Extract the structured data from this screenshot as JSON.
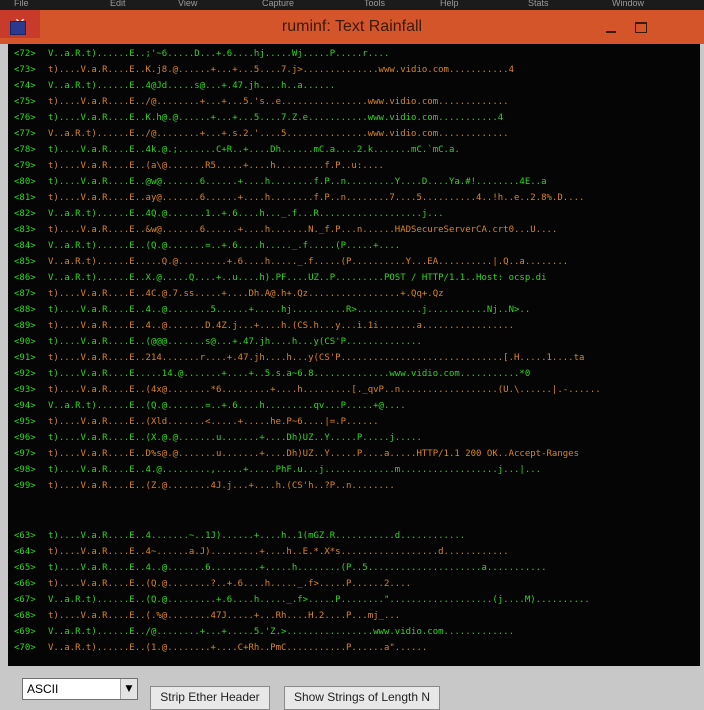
{
  "window": {
    "title": "ruminf: Text Rainfall",
    "close_label": "✕"
  },
  "taskbar_fragments": [
    "File",
    "Edit",
    "View",
    "Capture",
    "Tools",
    "Help",
    "Stats",
    "Window"
  ],
  "rows_group_a": [
    {
      "n": "<72>",
      "t": "V..a.R.t)......E..;'~6.....D...+.6....hj.....Wj.....P.....r...."
    },
    {
      "n": "<73>",
      "t": "t)....V.a.R....E..K.j8.@......+...+...5....7.j>..............www.vidio.com...........4"
    },
    {
      "n": "<74>",
      "t": "V..a.R.t)......E..4@Jd.....s@...+.47.jh....h..a......"
    },
    {
      "n": "<75>",
      "t": "t)....V.a.R....E../@........+...+...5.'s..e................www.vidio.com............."
    },
    {
      "n": "<76>",
      "t": "t)....V.a.R....E..K.h@.@......+...+...5....7.Z.e...........www.vidio.com...........4"
    },
    {
      "n": "<77>",
      "t": "V..a.R.t)......E../@........+...+.s.2.'....5...............www.vidio.com............."
    },
    {
      "n": "<78>",
      "t": "t)....V.a.R....E..4k.@.;.......C+R..+....Dh......mC.a....2.k.......mC.`mC.a."
    },
    {
      "n": "<79>",
      "t": "t)....V.a.R....E..(a\\@.......R5.....+....h.........f.P..u:...."
    },
    {
      "n": "<80>",
      "t": "t)....V.a.R....E..@w@.......6......+....h........f.P..n.........Y....D....Ya.#!........4E..a"
    },
    {
      "n": "<81>",
      "t": "t)....V.a.R....E..ay@.......6......+....h........f.P..n........7....5..........4..!h..e..2.8%.D...."
    },
    {
      "n": "<82>",
      "t": "V..a.R.t)......E..4Q.@.......1..+.6....h..._.f...R...................j..."
    },
    {
      "n": "<83>",
      "t": "t)....V.a.R....E..&w@.......6......+....h.......N._f.P...n......HADSecureServerCA.crt0...U...."
    },
    {
      "n": "<84>",
      "t": "V..a.R.t)......E..(Q.@.......=..+.6....h....._.f.....(P.....+...."
    },
    {
      "n": "<85>",
      "t": "V..a.R.t)......E.....Q.@.........+.6....h....._.f.....(P..........Y...EA..........|.Q..a........"
    },
    {
      "n": "<86>",
      "t": "V..a.R.t)......E..X.@.....Q....+..u....h).PF....UZ..P.........POST / HTTP/1.1..Host: ocsp.di"
    },
    {
      "n": "<87>",
      "t": "t)....V.a.R....E..4C.@.7.ss.....+....Dh.A@.h+.Qz.................+.Qq+.Qz"
    },
    {
      "n": "<88>",
      "t": "t)....V.a.R....E..4..@........5......+.....hj..........R>............j...........Nj..N>.."
    },
    {
      "n": "<89>",
      "t": "t)....V.a.R....E..4..@.......D.4Z.j...+....h.(CS.h...y...i.1i.......a................."
    },
    {
      "n": "<90>",
      "t": "t)....V.a.R....E..(@@@.......s@...+.47.jh....h...y(CS'P.............."
    },
    {
      "n": "<91>",
      "t": "t)....V.a.R....E..214.......r....+.47.jh....h...y(CS'P..............................[.H.....1....ta"
    },
    {
      "n": "<92>",
      "t": "t)....V.a.R....E.....14.@.......+....+..5.s.a~6.8..............www.vidio.com...........*0"
    },
    {
      "n": "<93>",
      "t": "t)....V.a.R....E..(4x@........*6.........+....h.........[._qvP..n..................(U.\\......|.-......"
    },
    {
      "n": "<94>",
      "t": "V..a.R.t)......E..(Q.@.......=..+.6....h.........qv...P.....+@...."
    },
    {
      "n": "<95>",
      "t": "t)....V.a.R....E..(Xld.......<.....+.....he.P~6....|=.P......"
    },
    {
      "n": "<96>",
      "t": "t)....V.a.R....E..(X.@.@.......u.......+....Dh)UZ..Y.....P.....j....."
    },
    {
      "n": "<97>",
      "t": "t)....V.a.R....E..D%s@.@.......u.......+....Dh)UZ..Y.....P....a.....HTTP/1.1 200 OK..Accept-Ranges"
    },
    {
      "n": "<98>",
      "t": "t)....V.a.R....E..4.@.........,.....+.....PhF.u...j.............m..................j...|..."
    },
    {
      "n": "<99>",
      "t": "t)....V.a.R....E..(Z.@........4J.j...+....h.(CS'h..?P..n........"
    }
  ],
  "rows_group_b": [
    {
      "n": "<63>",
      "t": "t)....V.a.R....E..4.......~..1J)......+....h..1(mGZ.R...........d............"
    },
    {
      "n": "<64>",
      "t": "t)....V.a.R....E..4~......a.J).........+....h..E.*.X*s..................d............"
    },
    {
      "n": "<65>",
      "t": "t)....V.a.R....E..4..@.......6.........+.....h........(P..5.....................a..........."
    },
    {
      "n": "<66>",
      "t": "t)....V.a.R....E..(Q.@........?..+.6....h....._.f>.....P......2...."
    },
    {
      "n": "<67>",
      "t": "V..a.R.t)......E..(Q.@.........+.6....h....._.f>.....P........\"...................(j....M).........."
    },
    {
      "n": "<68>",
      "t": "t)....V.a.R....E..(.%@........47J.....+...Rh....H.2....P...mj_..."
    },
    {
      "n": "<69>",
      "t": "V..a.R.t)......E../@........+...+.....5.'Z.>................www.vidio.com............."
    },
    {
      "n": "<70>",
      "t": "V..a.R.t)......E..(1.@........+....C+Rh..PmC...........P......a\"......"
    }
  ],
  "controls": {
    "encoding_select": "ASCII",
    "strip_ether_button": "Strip Ether Header",
    "show_strings_button": "Show Strings of Length N"
  },
  "colors": {
    "titlebar": "#d4552a",
    "background": "#050505",
    "text_green": "#2dd81c",
    "text_orange": "#d9861c"
  }
}
